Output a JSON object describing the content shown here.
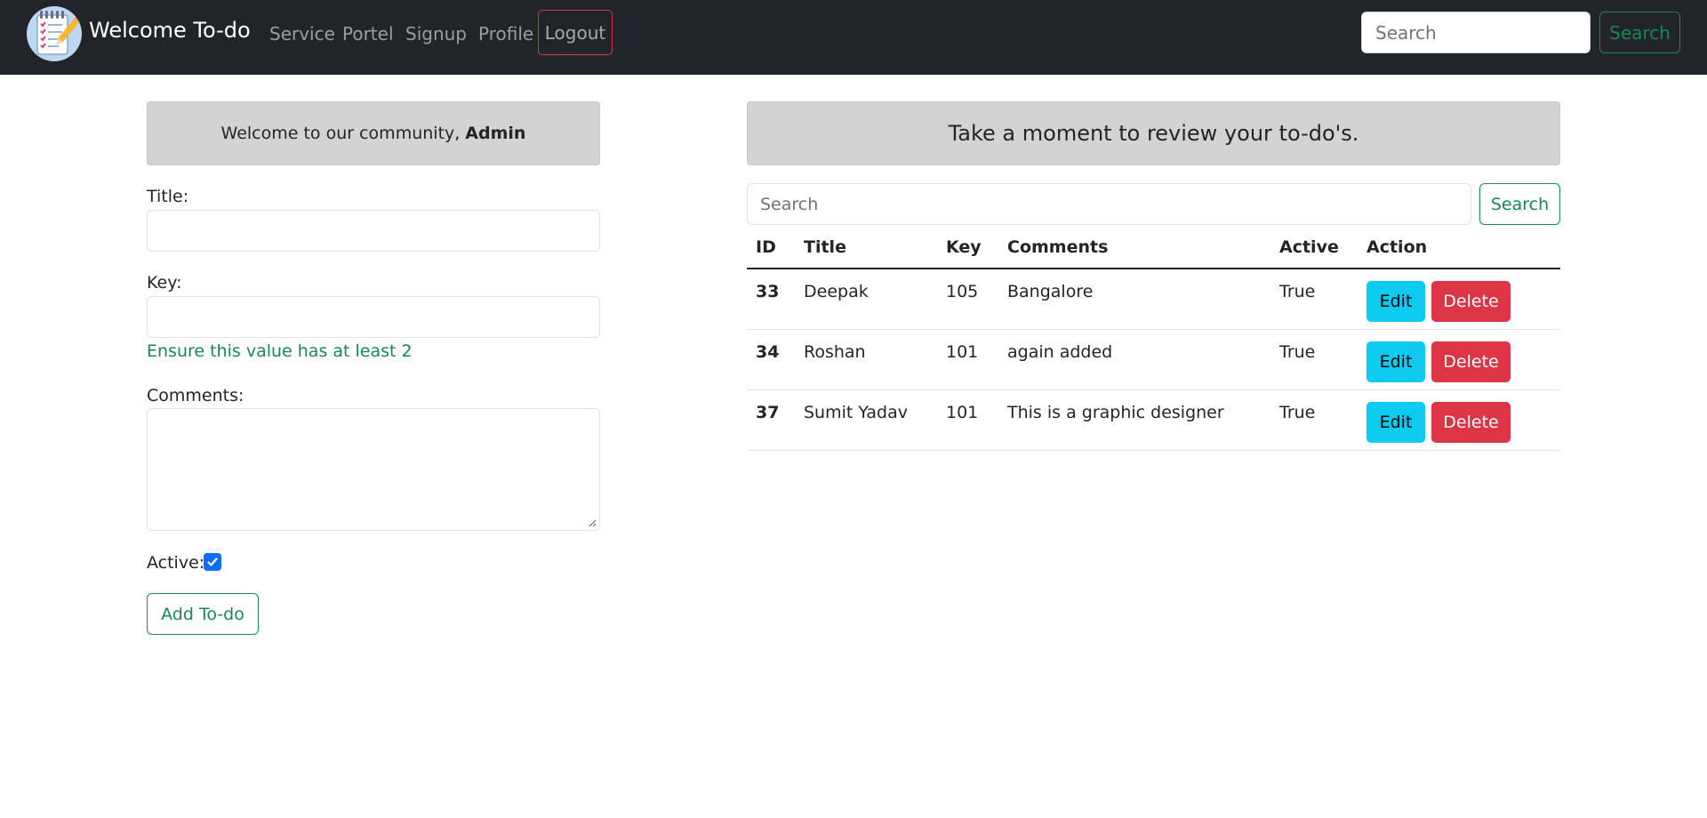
{
  "navbar": {
    "brand": "Welcome To-do",
    "links": [
      {
        "label": "Service"
      },
      {
        "label": "Portel"
      },
      {
        "label": "Signup"
      },
      {
        "label": "Profile"
      }
    ],
    "logout_label": "Logout",
    "search_placeholder": "Search",
    "search_button": "Search",
    "logo_icon": "notepad-pencil-icon"
  },
  "left": {
    "welcome_prefix": "Welcome to our community,",
    "welcome_user": "Admin",
    "title_label": "Title:",
    "key_label": "Key:",
    "key_help": "Ensure this value has at least 2",
    "comments_label": "Comments:",
    "active_label": "Active:",
    "active_checked": true,
    "add_button": "Add To-do"
  },
  "right": {
    "heading": "Take a moment to review your to-do's.",
    "search_placeholder": "Search",
    "search_button": "Search",
    "columns": [
      "ID",
      "Title",
      "Key",
      "Comments",
      "Active",
      "Action"
    ],
    "rows": [
      {
        "id": "33",
        "title": "Deepak",
        "key": "105",
        "comments": "Bangalore",
        "active": "True"
      },
      {
        "id": "34",
        "title": "Roshan",
        "key": "101",
        "comments": "again added",
        "active": "True"
      },
      {
        "id": "37",
        "title": "Sumit Yadav",
        "key": "101",
        "comments": "This is a graphic designer",
        "active": "True"
      }
    ],
    "edit_label": "Edit",
    "delete_label": "Delete"
  },
  "colors": {
    "navbar_bg": "#212529",
    "success": "#198754",
    "danger": "#dc3545",
    "info": "#0dcaf0",
    "primary": "#0d6efd",
    "panel_bg": "#d3d3d3"
  }
}
